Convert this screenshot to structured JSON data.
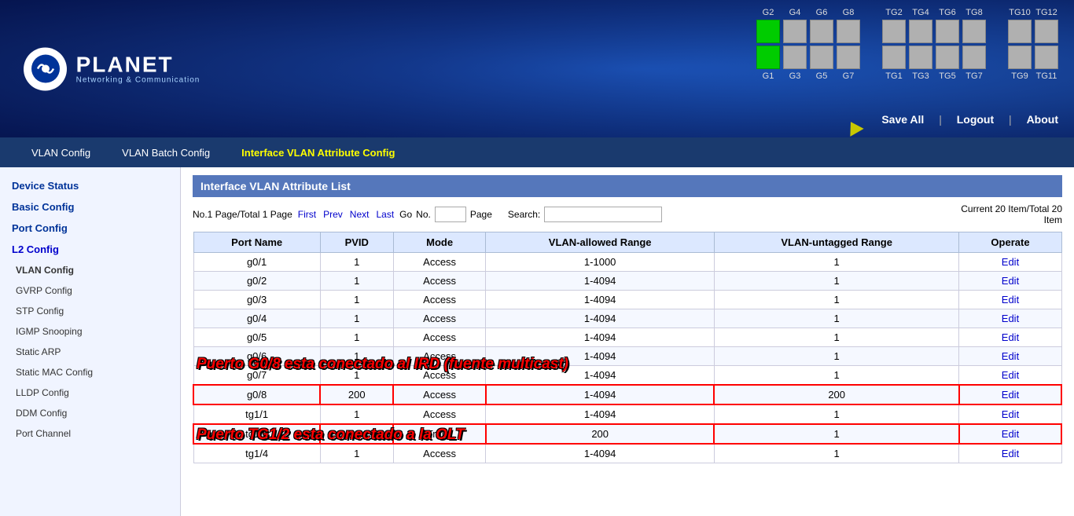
{
  "header": {
    "logo_planet": "PLANET",
    "logo_subtitle": "Networking & Communication",
    "save_all": "Save All",
    "logout": "Logout",
    "about": "About"
  },
  "navbar": {
    "items": [
      {
        "label": "VLAN Config",
        "active": false
      },
      {
        "label": "VLAN Batch Config",
        "active": false
      },
      {
        "label": "Interface VLAN Attribute Config",
        "active": true
      }
    ]
  },
  "ports": {
    "top_labels": [
      "G2",
      "G4",
      "G6",
      "G8",
      "",
      "TG2",
      "TG4",
      "TG6",
      "TG8",
      "",
      "TG10",
      "TG12"
    ],
    "bottom_labels": [
      "G1",
      "G3",
      "G5",
      "G7",
      "",
      "TG1",
      "TG3",
      "TG5",
      "TG7",
      "",
      "TG9",
      "TG11"
    ],
    "top_states": [
      true,
      false,
      false,
      false,
      null,
      false,
      false,
      false,
      false,
      null,
      false,
      false
    ],
    "bottom_states": [
      true,
      false,
      false,
      false,
      null,
      false,
      false,
      false,
      false,
      null,
      false,
      false
    ]
  },
  "sidebar": {
    "items": [
      {
        "label": "Device Status",
        "type": "section",
        "active": false
      },
      {
        "label": "Basic Config",
        "type": "section",
        "active": false
      },
      {
        "label": "Port Config",
        "type": "section",
        "active": false
      },
      {
        "label": "L2 Config",
        "type": "section",
        "active": true
      },
      {
        "label": "VLAN Config",
        "type": "sub",
        "active": true
      },
      {
        "label": "GVRP Config",
        "type": "sub",
        "active": false
      },
      {
        "label": "STP Config",
        "type": "sub",
        "active": false
      },
      {
        "label": "IGMP Snooping",
        "type": "sub",
        "active": false
      },
      {
        "label": "Static ARP",
        "type": "sub",
        "active": false
      },
      {
        "label": "Static MAC Config",
        "type": "sub",
        "active": false
      },
      {
        "label": "LLDP Config",
        "type": "sub",
        "active": false
      },
      {
        "label": "DDM Config",
        "type": "sub",
        "active": false
      },
      {
        "label": "Port Channel",
        "type": "sub",
        "active": false
      }
    ]
  },
  "content": {
    "title": "Interface VLAN Attribute List",
    "pagination": {
      "page_info": "No.1 Page/Total 1 Page",
      "first": "First",
      "prev": "Prev",
      "next": "Next",
      "last": "Last",
      "go": "Go",
      "no_label": "No.",
      "page_label": "Page",
      "search_label": "Search:",
      "current_info_line1": "Current 20 Item/Total 20",
      "current_info_line2": "Item"
    },
    "table": {
      "headers": [
        "Port Name",
        "PVID",
        "Mode",
        "VLAN-allowed Range",
        "VLAN-untagged Range",
        "Operate"
      ],
      "rows": [
        {
          "port": "g0/1",
          "pvid": "1",
          "mode": "Access",
          "allowed": "1-1000",
          "untagged": "1",
          "operate": "Edit",
          "highlight": false
        },
        {
          "port": "g0/2",
          "pvid": "1",
          "mode": "Access",
          "allowed": "1-4094",
          "untagged": "1",
          "operate": "Edit",
          "highlight": false
        },
        {
          "port": "g0/3",
          "pvid": "1",
          "mode": "Access",
          "allowed": "1-4094",
          "untagged": "1",
          "operate": "Edit",
          "highlight": false
        },
        {
          "port": "g0/4",
          "pvid": "1",
          "mode": "Access",
          "allowed": "1-4094",
          "untagged": "1",
          "operate": "Edit",
          "highlight": false
        },
        {
          "port": "g0/5",
          "pvid": "1",
          "mode": "Access",
          "allowed": "1-4094",
          "untagged": "1",
          "operate": "Edit",
          "highlight": false
        },
        {
          "port": "g0/6",
          "pvid": "1",
          "mode": "Access",
          "allowed": "1-4094",
          "untagged": "1",
          "operate": "Edit",
          "highlight": false
        },
        {
          "port": "g0/7",
          "pvid": "1",
          "mode": "Access",
          "allowed": "1-4094",
          "untagged": "1",
          "operate": "Edit",
          "highlight": false
        },
        {
          "port": "g0/8",
          "pvid": "200",
          "mode": "Access",
          "allowed": "1-4094",
          "untagged": "200",
          "operate": "Edit",
          "highlight": true
        },
        {
          "port": "tg1/1",
          "pvid": "1",
          "mode": "Access",
          "allowed": "1-4094",
          "untagged": "1",
          "operate": "Edit",
          "highlight": false
        },
        {
          "port": "tg1/2",
          "pvid": "1",
          "mode": "Trunk",
          "allowed": "200",
          "untagged": "1",
          "operate": "Edit",
          "highlight": true
        },
        {
          "port": "tg1/4",
          "pvid": "1",
          "mode": "Access",
          "allowed": "1-4094",
          "untagged": "1",
          "operate": "Edit",
          "highlight": false
        }
      ]
    },
    "overlay1": "Puerto G0/8 esta conectado al IRD (fuente multicast)",
    "overlay2": "Puerto TG1/2 esta conectado a la OLT"
  }
}
